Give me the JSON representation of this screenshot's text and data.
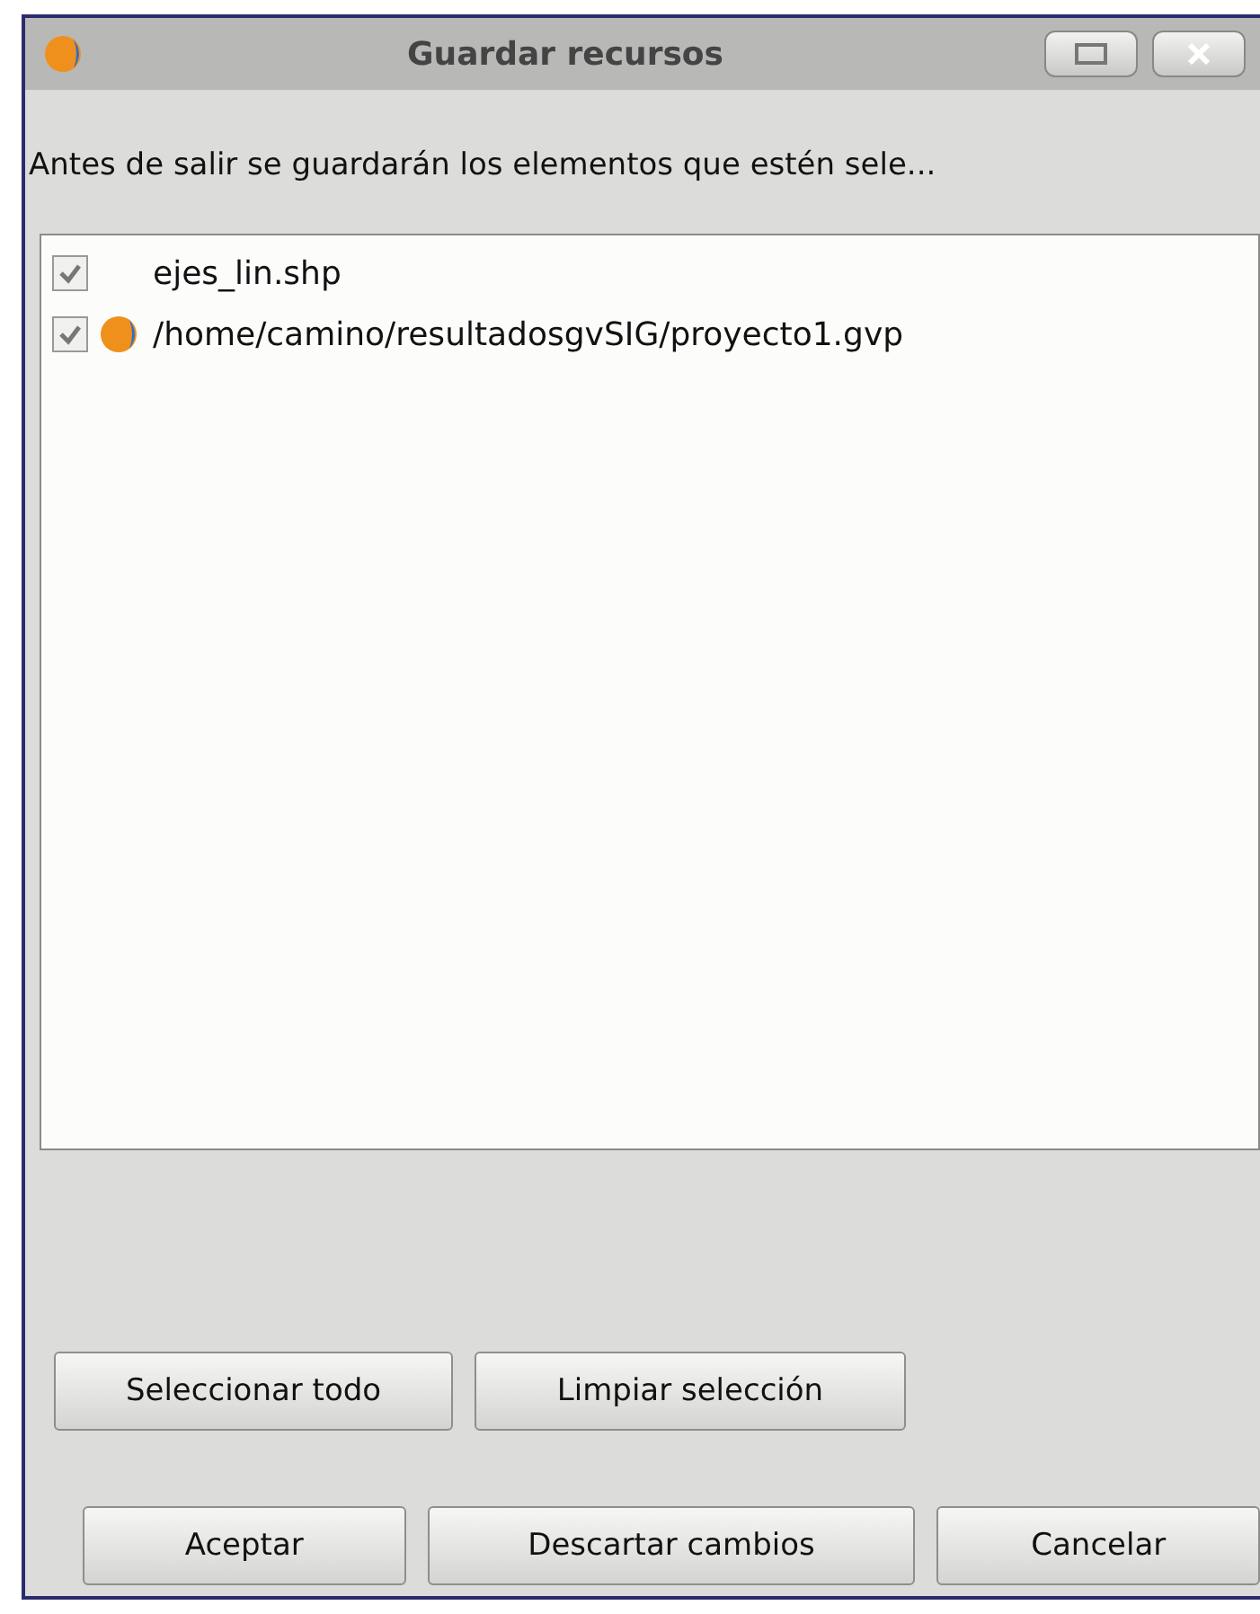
{
  "window": {
    "title": "Guardar recursos"
  },
  "message": "Antes de salir se guardarán los elementos que estén sele...",
  "items": [
    {
      "label": "ejes_lin.shp",
      "checked": true,
      "kind": "file"
    },
    {
      "label": "/home/camino/resultadosgvSIG/proyecto1.gvp",
      "checked": true,
      "kind": "project"
    }
  ],
  "selection_buttons": [
    "Seleccionar todo",
    "Limpiar selección"
  ],
  "buttons": [
    "Aceptar",
    "Descartar cambios",
    "Cancelar"
  ]
}
